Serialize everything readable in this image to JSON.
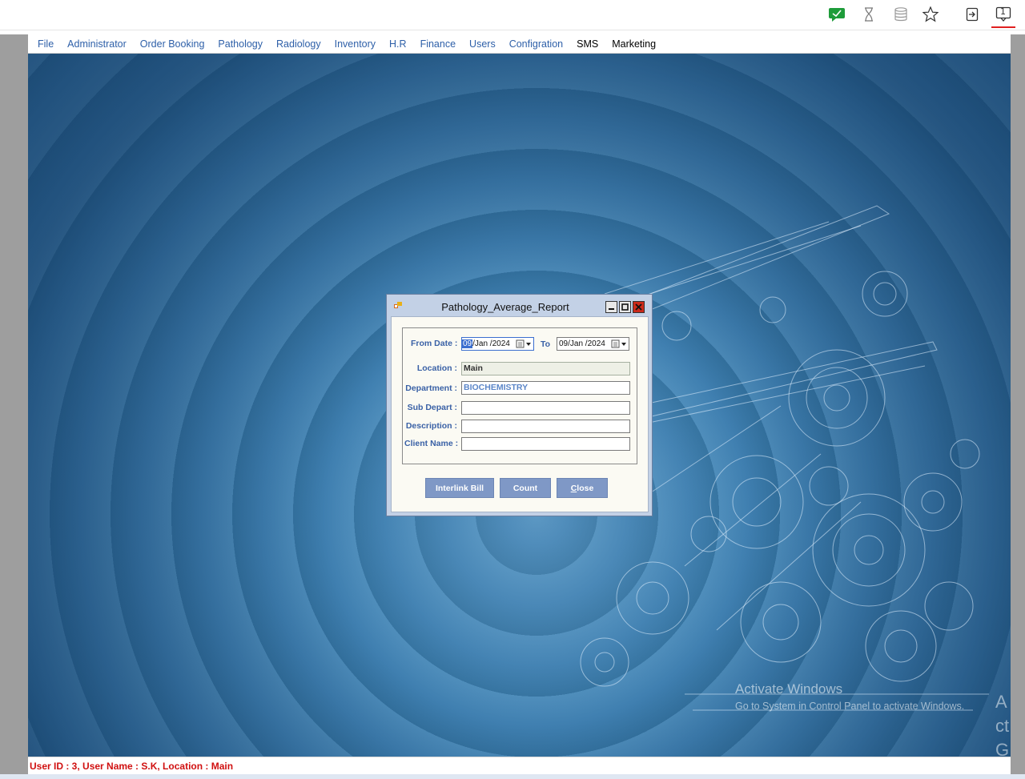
{
  "toolbar": {
    "icons": [
      "chat-bubble-icon",
      "hourglass-icon",
      "database-icon",
      "star-icon",
      "sign-in-icon",
      "notification-icon"
    ],
    "notification_count": "1"
  },
  "menu": {
    "items": [
      "File",
      "Administrator",
      "Order Booking",
      "Pathology",
      "Radiology",
      "Inventory",
      "H.R",
      "Finance",
      "Users",
      "Configration",
      "SMS",
      "Marketing"
    ]
  },
  "dialog": {
    "title": "Pathology_Average_Report",
    "from_date_label": "From Date :",
    "from_date_day": "09",
    "from_date_rest": "/Jan /2024",
    "to_label": "To",
    "to_date": "09/Jan /2024",
    "location_label": "Location :",
    "location_value": "Main",
    "department_label": "Department :",
    "department_value": "BIOCHEMISTRY",
    "sub_depart_label": "Sub Depart :",
    "sub_depart_value": "",
    "description_label": "Description :",
    "description_value": "",
    "client_name_label": "Client Name :",
    "client_name_value": "",
    "buttons": {
      "interlink": "Interlink Bill",
      "count": "Count",
      "close_accel": "C",
      "close_rest": "lose"
    }
  },
  "watermark": {
    "line1": "Activate Windows",
    "line2": "Go to System in Control Panel to activate Windows.",
    "clipped": "Act Go t"
  },
  "status": {
    "text": "User ID : 3, User Name : S.K, Location : Main"
  },
  "colors": {
    "menu_text": "#2d5fa8",
    "status_text": "#d01010",
    "dialog_label": "#3a61a6",
    "button_bg": "#7f98c6"
  }
}
